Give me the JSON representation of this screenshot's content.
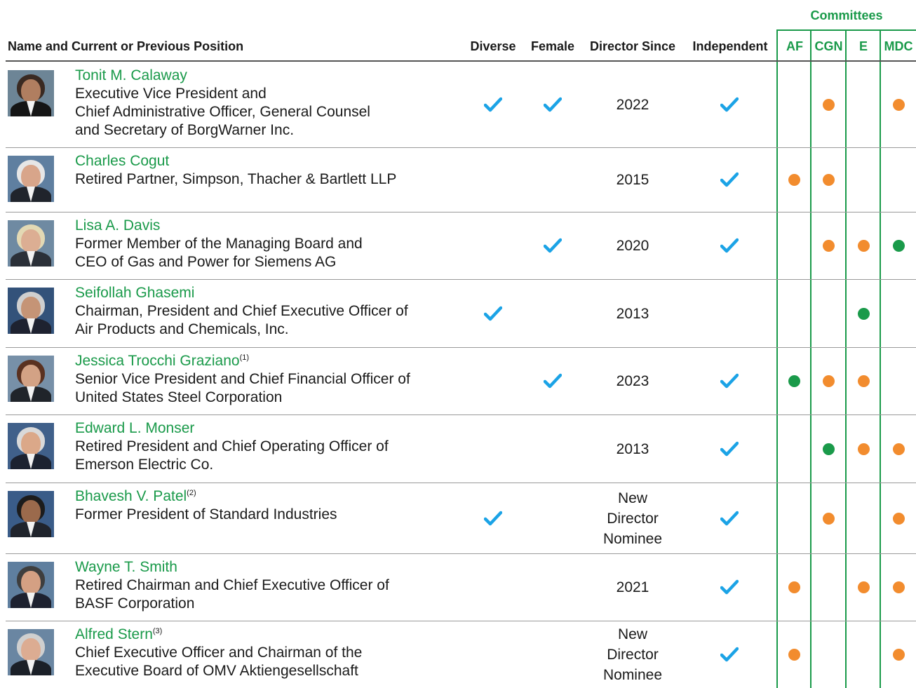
{
  "header": {
    "committees_label": "Committees",
    "columns": {
      "name": "Name and Current or Previous Position",
      "diverse": "Diverse",
      "female": "Female",
      "director_since": "Director Since",
      "independent": "Independent",
      "af": "AF",
      "cgn": "CGN",
      "e": "E",
      "mdc": "MDC"
    }
  },
  "colors": {
    "green": "#1a9a4a",
    "orange": "#f28c2e",
    "check": "#1ba3e6",
    "rule": "#9a9a9a"
  },
  "directors": [
    {
      "name": "Tonit M. Calaway",
      "footnote": "",
      "position_lines": [
        "Executive Vice President and",
        "Chief Administrative Officer, General Counsel",
        "and Secretary of BorgWarner Inc."
      ],
      "diverse": true,
      "female": true,
      "director_since": [
        "2022"
      ],
      "independent": true,
      "committees": {
        "AF": "",
        "CGN": "member",
        "E": "",
        "MDC": "member"
      }
    },
    {
      "name": "Charles Cogut",
      "footnote": "",
      "position_lines": [
        "Retired Partner, Simpson, Thacher & Bartlett LLP"
      ],
      "diverse": false,
      "female": false,
      "director_since": [
        "2015"
      ],
      "independent": true,
      "committees": {
        "AF": "member",
        "CGN": "member",
        "E": "",
        "MDC": ""
      }
    },
    {
      "name": "Lisa A. Davis",
      "footnote": "",
      "position_lines": [
        "Former Member of the Managing Board and",
        "CEO of Gas and Power for Siemens AG"
      ],
      "diverse": false,
      "female": true,
      "director_since": [
        "2020"
      ],
      "independent": true,
      "committees": {
        "AF": "",
        "CGN": "member",
        "E": "member",
        "MDC": "chair"
      }
    },
    {
      "name": "Seifollah Ghasemi",
      "footnote": "",
      "position_lines": [
        "Chairman, President and Chief Executive Officer of",
        "Air Products and Chemicals, Inc."
      ],
      "diverse": true,
      "female": false,
      "director_since": [
        "2013"
      ],
      "independent": false,
      "committees": {
        "AF": "",
        "CGN": "",
        "E": "chair",
        "MDC": ""
      }
    },
    {
      "name": "Jessica Trocchi Graziano",
      "footnote": "(1)",
      "position_lines": [
        "Senior Vice President and Chief Financial Officer of",
        "United States Steel Corporation"
      ],
      "diverse": false,
      "female": true,
      "director_since": [
        "2023"
      ],
      "independent": true,
      "committees": {
        "AF": "chair",
        "CGN": "member",
        "E": "member",
        "MDC": ""
      }
    },
    {
      "name": "Edward L. Monser",
      "footnote": "",
      "position_lines": [
        "Retired President and Chief Operating Officer of",
        "Emerson Electric Co."
      ],
      "diverse": false,
      "female": false,
      "director_since": [
        "2013"
      ],
      "independent": true,
      "committees": {
        "AF": "",
        "CGN": "chair",
        "E": "member",
        "MDC": "member"
      }
    },
    {
      "name": "Bhavesh V. Patel",
      "footnote": "(2)",
      "position_lines": [
        "Former President of Standard Industries"
      ],
      "diverse": true,
      "female": false,
      "director_since": [
        "New",
        "Director",
        "Nominee"
      ],
      "independent": true,
      "committees": {
        "AF": "",
        "CGN": "member",
        "E": "",
        "MDC": "member"
      }
    },
    {
      "name": "Wayne T. Smith",
      "footnote": "",
      "position_lines": [
        "Retired Chairman and Chief Executive Officer of",
        "BASF Corporation"
      ],
      "diverse": false,
      "female": false,
      "director_since": [
        "2021"
      ],
      "independent": true,
      "committees": {
        "AF": "member",
        "CGN": "",
        "E": "member",
        "MDC": "member"
      }
    },
    {
      "name": "Alfred Stern",
      "footnote": "(3)",
      "position_lines": [
        "Chief Executive Officer and Chairman of the",
        "Executive Board of OMV Aktiengesellschaft"
      ],
      "diverse": false,
      "female": false,
      "director_since": [
        "New",
        "Director",
        "Nominee"
      ],
      "independent": true,
      "committees": {
        "AF": "member",
        "CGN": "",
        "E": "",
        "MDC": "member"
      }
    }
  ]
}
